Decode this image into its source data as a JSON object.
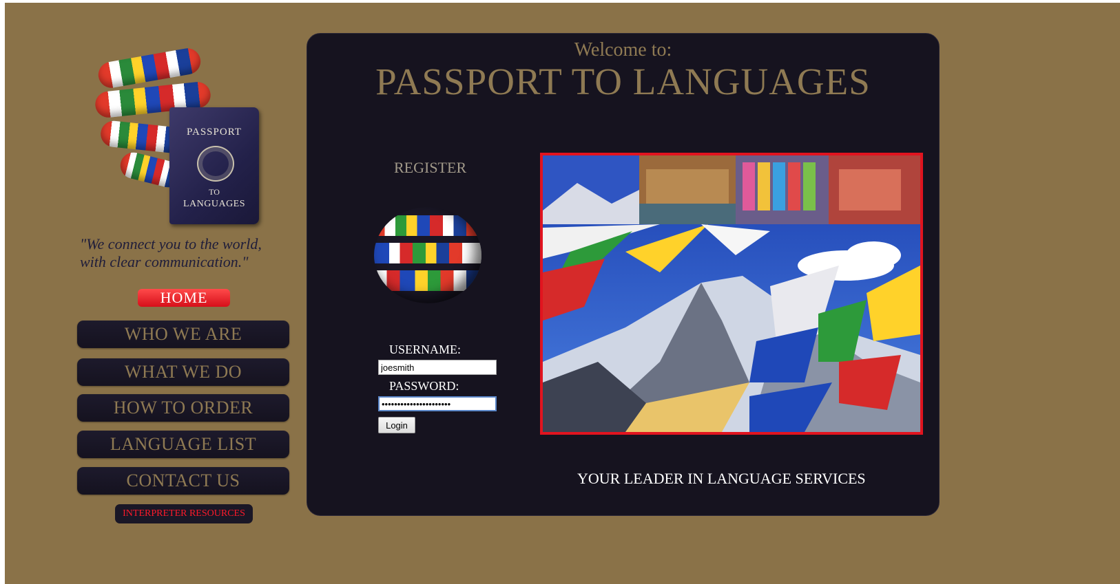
{
  "brand": {
    "logo": {
      "icon": "passport-globe-logo",
      "lines": [
        "PASSPORT",
        "TO",
        "LANGUAGES"
      ]
    },
    "tagline": [
      "\"We connect you to the world,",
      "with clear communication.\""
    ]
  },
  "nav": {
    "home": "HOME",
    "items": [
      "WHO WE ARE",
      "WHAT WE DO",
      "HOW TO ORDER",
      "LANGUAGE LIST",
      "CONTACT US"
    ],
    "interpreter": "INTERPRETER RESOURCES"
  },
  "main": {
    "welcome": "Welcome to:",
    "title": "PASSPORT TO LANGUAGES",
    "register": "REGISTER",
    "globe_icon": "flag-globe-icon",
    "login": {
      "username_label": "USERNAME:",
      "username_value": "joesmith",
      "password_label": "PASSWORD:",
      "password_value": "••••••••••••••••••••••",
      "button": "Login"
    },
    "hero_image": "mountain-prayer-flags-collage",
    "footer_slogan": "YOUR LEADER IN LANGUAGE SERVICES"
  },
  "colors": {
    "background": "#8a7248",
    "panel": "#16131f",
    "gold_text": "#8f7a53",
    "home_red": "#e1141f",
    "interpreter_red": "#ff1a2a",
    "hero_border": "#e1141f"
  }
}
